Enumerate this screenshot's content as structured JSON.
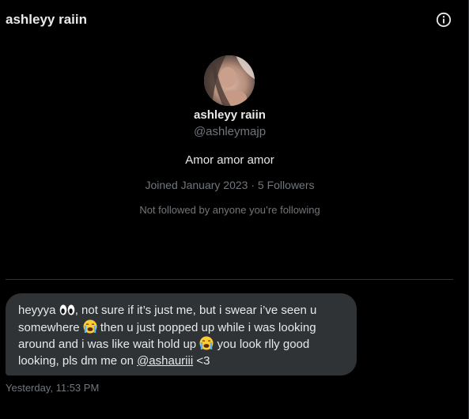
{
  "header": {
    "title": "ashleyy raiin",
    "info_icon": "info-circle-icon"
  },
  "profile": {
    "avatar": "profile-avatar",
    "name": "ashleyy raiin",
    "handle": "@ashleymajp",
    "bio": "Amor amor amor",
    "joined": "Joined January 2023",
    "separator": "·",
    "followers": "5 Followers",
    "followed_by": "Not followed by anyone you’re following"
  },
  "message": {
    "line1_a": "heyyya",
    "line1_b": ", not sure if it’s just me, but i swear i’ve seen u",
    "line2_a": "somewhere",
    "line2_b": "then u just popped up while i was looking",
    "line3_a": "around and i was like wait hold up",
    "line3_b": "you look rlly good",
    "line4_a": "looking, pls dm me on",
    "mention": "@ashauriii",
    "line4_b": " <3",
    "emojis": [
      "eyes-emoji",
      "crying-face-emoji",
      "crying-face-emoji"
    ],
    "timestamp": "Yesterday, 11:53 PM"
  },
  "colors": {
    "background": "#000000",
    "text": "#e7e9ea",
    "secondary_text": "#71767b",
    "bubble": "#2f3336",
    "divider": "#2f3336"
  }
}
